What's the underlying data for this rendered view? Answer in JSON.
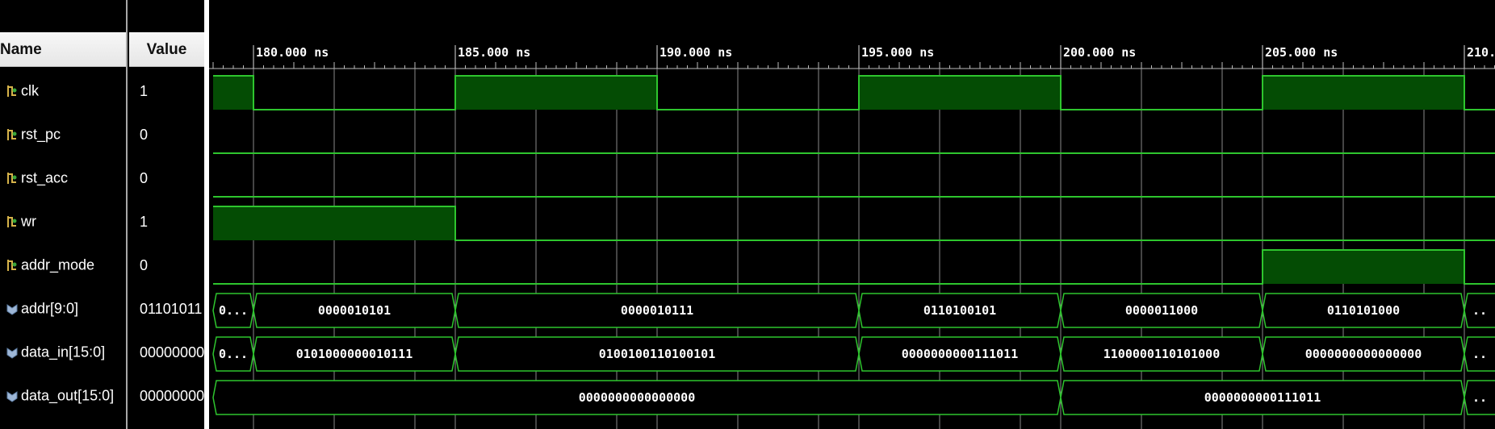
{
  "columns": {
    "name": "Name",
    "value": "Value"
  },
  "colors": {
    "signal_line": "#2ec52e",
    "signal_fill": "#044c04",
    "grid": "#8a8a8a",
    "background": "#000000",
    "text": "#ffffff"
  },
  "time_axis": {
    "unit": "ns",
    "start": 179.0,
    "end": 210.0,
    "major_ticks": [
      {
        "t": 180,
        "label": "180.000 ns"
      },
      {
        "t": 185,
        "label": "185.000 ns"
      },
      {
        "t": 190,
        "label": "190.000 ns"
      },
      {
        "t": 195,
        "label": "195.000 ns"
      },
      {
        "t": 200,
        "label": "200.000 ns"
      },
      {
        "t": 205,
        "label": "205.000 ns"
      },
      {
        "t": 210,
        "label": "210."
      }
    ],
    "grid_times": [
      180,
      182,
      184,
      185,
      187,
      189,
      190,
      192,
      194,
      195,
      197,
      199,
      200,
      202,
      204,
      205,
      207,
      209,
      210
    ]
  },
  "signals": [
    {
      "name": "clk",
      "value": "1",
      "type": "bit",
      "icon": "bit-signal-icon",
      "segments": [
        [
          179,
          180,
          1
        ],
        [
          180,
          185,
          0
        ],
        [
          185,
          190,
          1
        ],
        [
          190,
          195,
          0
        ],
        [
          195,
          200,
          1
        ],
        [
          200,
          205,
          0
        ],
        [
          205,
          210,
          1
        ],
        [
          210,
          211,
          0
        ]
      ]
    },
    {
      "name": "rst_pc",
      "value": "0",
      "type": "bit",
      "icon": "bit-signal-icon",
      "segments": [
        [
          179,
          211,
          0
        ]
      ]
    },
    {
      "name": "rst_acc",
      "value": "0",
      "type": "bit",
      "icon": "bit-signal-icon",
      "segments": [
        [
          179,
          211,
          0
        ]
      ]
    },
    {
      "name": "wr",
      "value": "1",
      "type": "bit",
      "icon": "bit-signal-icon",
      "segments": [
        [
          179,
          185,
          1
        ],
        [
          185,
          211,
          0
        ]
      ]
    },
    {
      "name": "addr_mode",
      "value": "0",
      "type": "bit",
      "icon": "bit-signal-icon",
      "segments": [
        [
          179,
          205,
          0
        ],
        [
          205,
          210,
          1
        ],
        [
          210,
          211,
          0
        ]
      ]
    },
    {
      "name": "addr[9:0]",
      "value": "01101011",
      "type": "bus",
      "icon": "bus-signal-icon",
      "segments": [
        [
          179,
          180,
          "0..."
        ],
        [
          180,
          185,
          "0000010101"
        ],
        [
          185,
          195,
          "0000010111"
        ],
        [
          195,
          200,
          "0110100101"
        ],
        [
          200,
          205,
          "0000011000"
        ],
        [
          205,
          210,
          "0110101000"
        ],
        [
          210,
          211,
          ".."
        ]
      ]
    },
    {
      "name": "data_in[15:0]",
      "value": "00000000",
      "type": "bus",
      "icon": "bus-signal-icon",
      "segments": [
        [
          179,
          180,
          "0..."
        ],
        [
          180,
          185,
          "0101000000010111"
        ],
        [
          185,
          195,
          "0100100110100101"
        ],
        [
          195,
          200,
          "0000000000111011"
        ],
        [
          200,
          205,
          "1100000110101000"
        ],
        [
          205,
          210,
          "0000000000000000"
        ],
        [
          210,
          211,
          ".."
        ]
      ]
    },
    {
      "name": "data_out[15:0]",
      "value": "00000000",
      "type": "bus",
      "icon": "bus-signal-icon",
      "segments": [
        [
          179,
          200,
          "0000000000000000"
        ],
        [
          200,
          210,
          "0000000000111011"
        ],
        [
          210,
          211,
          ".."
        ]
      ]
    }
  ]
}
